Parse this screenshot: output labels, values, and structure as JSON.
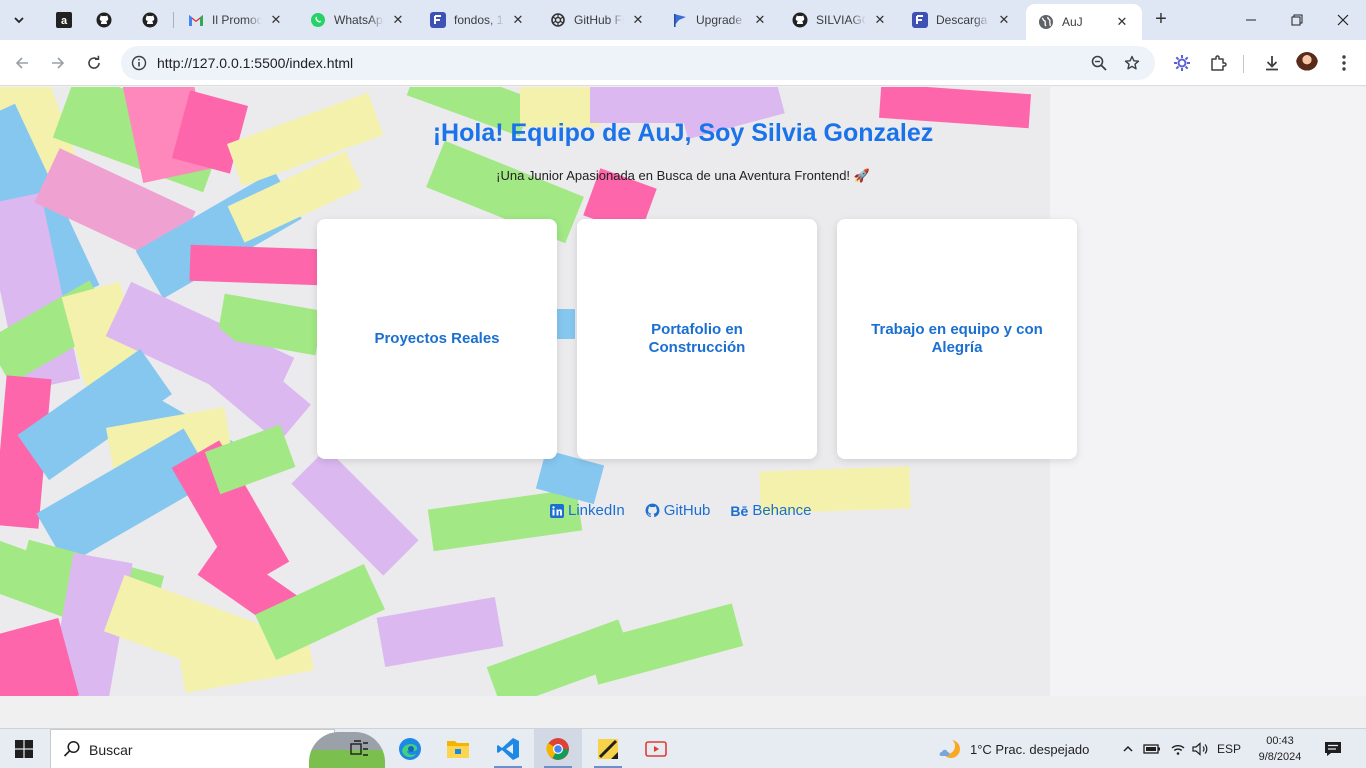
{
  "browser": {
    "tabs": [
      {
        "label": "",
        "icon": "amazon-icon"
      },
      {
        "label": "",
        "icon": "github-icon"
      },
      {
        "label": "",
        "icon": "github-icon"
      },
      {
        "label": "Il Promoc",
        "icon": "gmail-icon"
      },
      {
        "label": "WhatsApp",
        "icon": "whatsapp-icon"
      },
      {
        "label": "fondos, 1",
        "icon": "forms-icon"
      },
      {
        "label": "GitHub Fi",
        "icon": "openai-icon"
      },
      {
        "label": "Upgrade",
        "icon": "flag-icon"
      },
      {
        "label": "SILVIAGO",
        "icon": "github-icon"
      },
      {
        "label": "Descarga",
        "icon": "forms-icon"
      },
      {
        "label": "AuJ",
        "icon": "globe-icon",
        "active": true
      }
    ],
    "url": "http://127.0.0.1:5500/index.html"
  },
  "page": {
    "title": "¡Hola! Equipo de AuJ, Soy Silvia Gonzalez",
    "subtitle": "¡Una Junior Apasionada en Busca de una Aventura Frontend! 🚀",
    "cards": [
      {
        "label": "Proyectos Reales"
      },
      {
        "label": "Portafolio en Construcción"
      },
      {
        "label": "Trabajo en equipo y con Alegría"
      }
    ],
    "links": [
      {
        "label": "LinkedIn",
        "icon": "linkedin-icon"
      },
      {
        "label": "GitHub",
        "icon": "github-icon"
      },
      {
        "label": "Behance",
        "icon_text": "Bē"
      }
    ],
    "colors": {
      "title": "#1a73e8",
      "link": "#1a6fd0"
    }
  },
  "taskbar": {
    "search_placeholder": "Buscar",
    "weather": "1°C  Prac. despejado",
    "language": "ESP",
    "time": "00:43",
    "date": "9/8/2024"
  }
}
